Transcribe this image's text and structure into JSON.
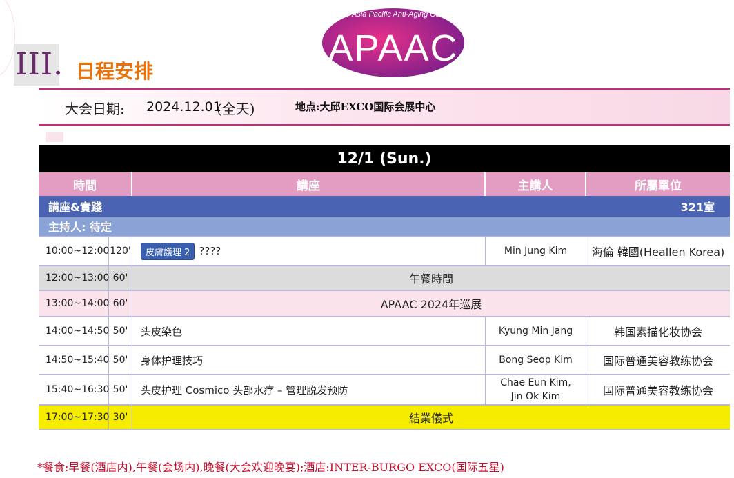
{
  "logo": {
    "top_text": "Asia Pacific Anti-Aging Conference",
    "wordmark": "APAAC",
    "colors": [
      "#e8308a",
      "#7a1f8a"
    ]
  },
  "section": {
    "number": "III.",
    "title": "日程安排"
  },
  "event": {
    "date_label": "大会日期:",
    "date_value": "2024.12.01",
    "date_note": "(全天)",
    "venue": "地点:大邱EXCO国际会展中心"
  },
  "schedule": {
    "day": "12/1 (Sun.)",
    "columns": {
      "time": "時間",
      "lecture": "講座",
      "speaker": "主講人",
      "affiliation": "所屬單位"
    },
    "track": {
      "name": "講座&實踐",
      "room": "321室"
    },
    "host": "主持人: 待定",
    "rows": [
      {
        "time": "10:00~12:00",
        "duration": "120'",
        "tag": "皮膚護理 2",
        "title": "????",
        "speaker": "Min Jung Kim",
        "affiliation": "海倫 韓國(Heallen Korea)"
      },
      {
        "time": "12:00~13:00",
        "duration": "60'",
        "span": "午餐時間"
      },
      {
        "time": "13:00~14:00",
        "duration": "60'",
        "span": "APAAC 2024年巡展"
      },
      {
        "time": "14:00~14:50",
        "duration": "50'",
        "title": "头皮染色",
        "speaker": "Kyung Min Jang",
        "affiliation": "韩国素描化妆协会"
      },
      {
        "time": "14:50~15:40",
        "duration": "50'",
        "title": "身体护理技巧",
        "speaker": "Bong Seop Kim",
        "affiliation": "国际普通美容教练协会"
      },
      {
        "time": "15:40~16:30",
        "duration": "50'",
        "title": "头皮护理 Cosmico 头部水疗 – 管理脱发预防",
        "speaker_line1": "Chae Eun Kim,",
        "speaker_line2": "Jin Ok Kim",
        "affiliation": "国际普通美容教练协会"
      },
      {
        "time": "17:00~17:30",
        "duration": "30'",
        "span": "結業儀式"
      }
    ]
  },
  "footer": "*餐食:早餐(酒店内),午餐(会场内),晚餐(大会欢迎晚宴);酒店:INTER-BURGO EXCO(国际五星)"
}
